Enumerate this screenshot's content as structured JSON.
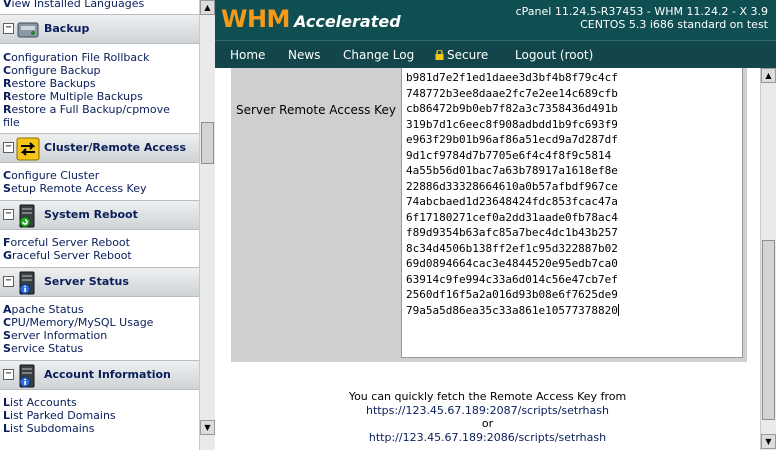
{
  "left_nav": {
    "top_partial_link": "View Installed Languages",
    "sections": [
      {
        "title": "Backup",
        "icon": "backup-icon",
        "links": [
          "Configuration File Rollback",
          "Configure Backup",
          "Restore Backups",
          "Restore Multiple Backups",
          "Restore a Full Backup/cpmove file"
        ]
      },
      {
        "title": "Cluster/Remote Access",
        "icon": "cluster-arrows-icon",
        "links": [
          "Configure Cluster",
          "Setup Remote Access Key"
        ]
      },
      {
        "title": "System Reboot",
        "icon": "server-reboot-icon",
        "links": [
          "Forceful Server Reboot",
          "Graceful Server Reboot"
        ]
      },
      {
        "title": "Server Status",
        "icon": "server-status-icon",
        "links": [
          "Apache Status",
          "CPU/Memory/MySQL Usage",
          "Server Information",
          "Service Status"
        ]
      },
      {
        "title": "Account Information",
        "icon": "account-info-icon",
        "links": [
          "List Accounts",
          "List Parked Domains",
          "List Subdomains"
        ]
      }
    ],
    "collapse_glyph": "−"
  },
  "header": {
    "logo_primary": "WHM",
    "logo_secondary": "Accelerated",
    "version_line1": "cPanel 11.24.5-R37453 - WHM 11.24.2 - X 3.9",
    "version_line2": "CENTOS 5.3 i686 standard on test"
  },
  "navbar": {
    "home": "Home",
    "news": "News",
    "changelog": "Change Log",
    "secure": "Secure",
    "logout": "Logout (root)"
  },
  "remote_access": {
    "label": "Server Remote Access Key",
    "key_lines": [
      "b981d7e2f1ed1daee3d3bf4b8f79c4cf",
      "748772b3ee8daae2fc7e2ee14c689cfb",
      "cb86472b9b0eb7f82a3c7358436d491b",
      "319b7d1c6eec8f908adbdd1b9fc693f9",
      "e963f29b01b96af86a51ecd9a7d287df",
      "9d1cf9784d7b7705e6f4c4f8f9c5814",
      "4a55b56d01bac7a63b78917a1618ef8e",
      "22886d33328664610a0b57afbdf967ce",
      "74abcbaed1d23648424fdc853fcac47a",
      "6f17180271cef0a2dd31aade0fb78ac4",
      "f89d9354b63afc85a7bec4dc1b43b257",
      "8c34d4506b138ff2ef1c95d322887b02",
      "69d0894664cac3e4844520e95edb7ca0",
      "63914c9fe994c33a6d014c56e47cb7ef",
      "2560df16f5a2a016d93b08e6f7625de9",
      "79a5a5d86ea35c33a861e10577378820"
    ]
  },
  "fetch_message": {
    "line1": "You can quickly fetch the Remote Access Key from",
    "url_https": "https://123.45.67.189:2087/scripts/setrhash",
    "or": "or",
    "url_http": "http://123.45.67.189:2086/scripts/setrhash"
  },
  "scroll_glyphs": {
    "up": "▲",
    "down": "▼"
  },
  "colors": {
    "header_bg": "#0f4f52",
    "logo_orange": "#f39a1a",
    "link_navy": "#0a1e5a",
    "cell_gray": "#cfcfcf"
  }
}
